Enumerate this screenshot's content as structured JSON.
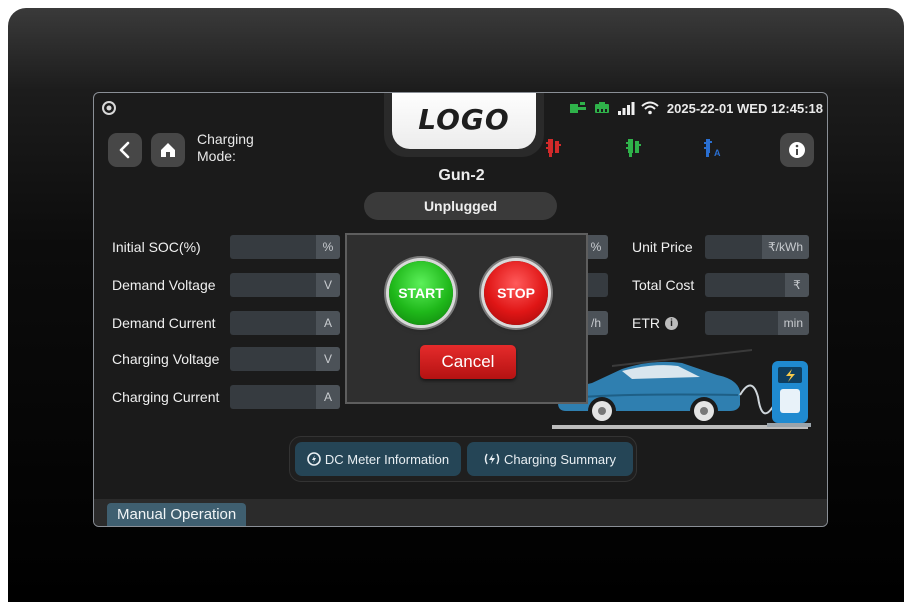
{
  "header": {
    "logo": "LOGO",
    "datetime": "2025-22-01 WED 12:45:18",
    "mode_label": "Charging Mode:",
    "gun_badge_a": "A"
  },
  "gun": {
    "title": "Gun-2",
    "status": "Unplugged"
  },
  "left_fields": [
    {
      "label": "Initial SOC(%)",
      "value": "",
      "unit": "%"
    },
    {
      "label": "Demand Voltage",
      "value": "",
      "unit": "V"
    },
    {
      "label": "Demand Current",
      "value": "",
      "unit": "A"
    },
    {
      "label": "Charging Voltage",
      "value": "",
      "unit": "V"
    },
    {
      "label": "Charging Current",
      "value": "",
      "unit": "A"
    }
  ],
  "middle_fields": [
    {
      "unit": "%"
    },
    {
      "unit": ""
    },
    {
      "unit": "/h"
    }
  ],
  "right_fields": [
    {
      "label": "Unit Price",
      "value": "",
      "unit": "₹/kWh"
    },
    {
      "label": "Total Cost",
      "value": "",
      "unit": "₹"
    },
    {
      "label": "ETR",
      "value": "",
      "unit": "min"
    }
  ],
  "modal": {
    "start_label": "START",
    "stop_label": "STOP",
    "cancel_label": "Cancel"
  },
  "tabs": [
    {
      "label": "DC Meter Information"
    },
    {
      "label": "Charging Summary"
    }
  ],
  "footer": {
    "manual_label": "Manual Operation"
  },
  "colors": {
    "start": "#1fb81a",
    "stop": "#e01616",
    "cancel": "#c41a1a",
    "tab_bg": "#254556",
    "gun_red": "#d12a2a",
    "gun_green": "#2fb24a",
    "gun_blue": "#2a6fd1"
  }
}
